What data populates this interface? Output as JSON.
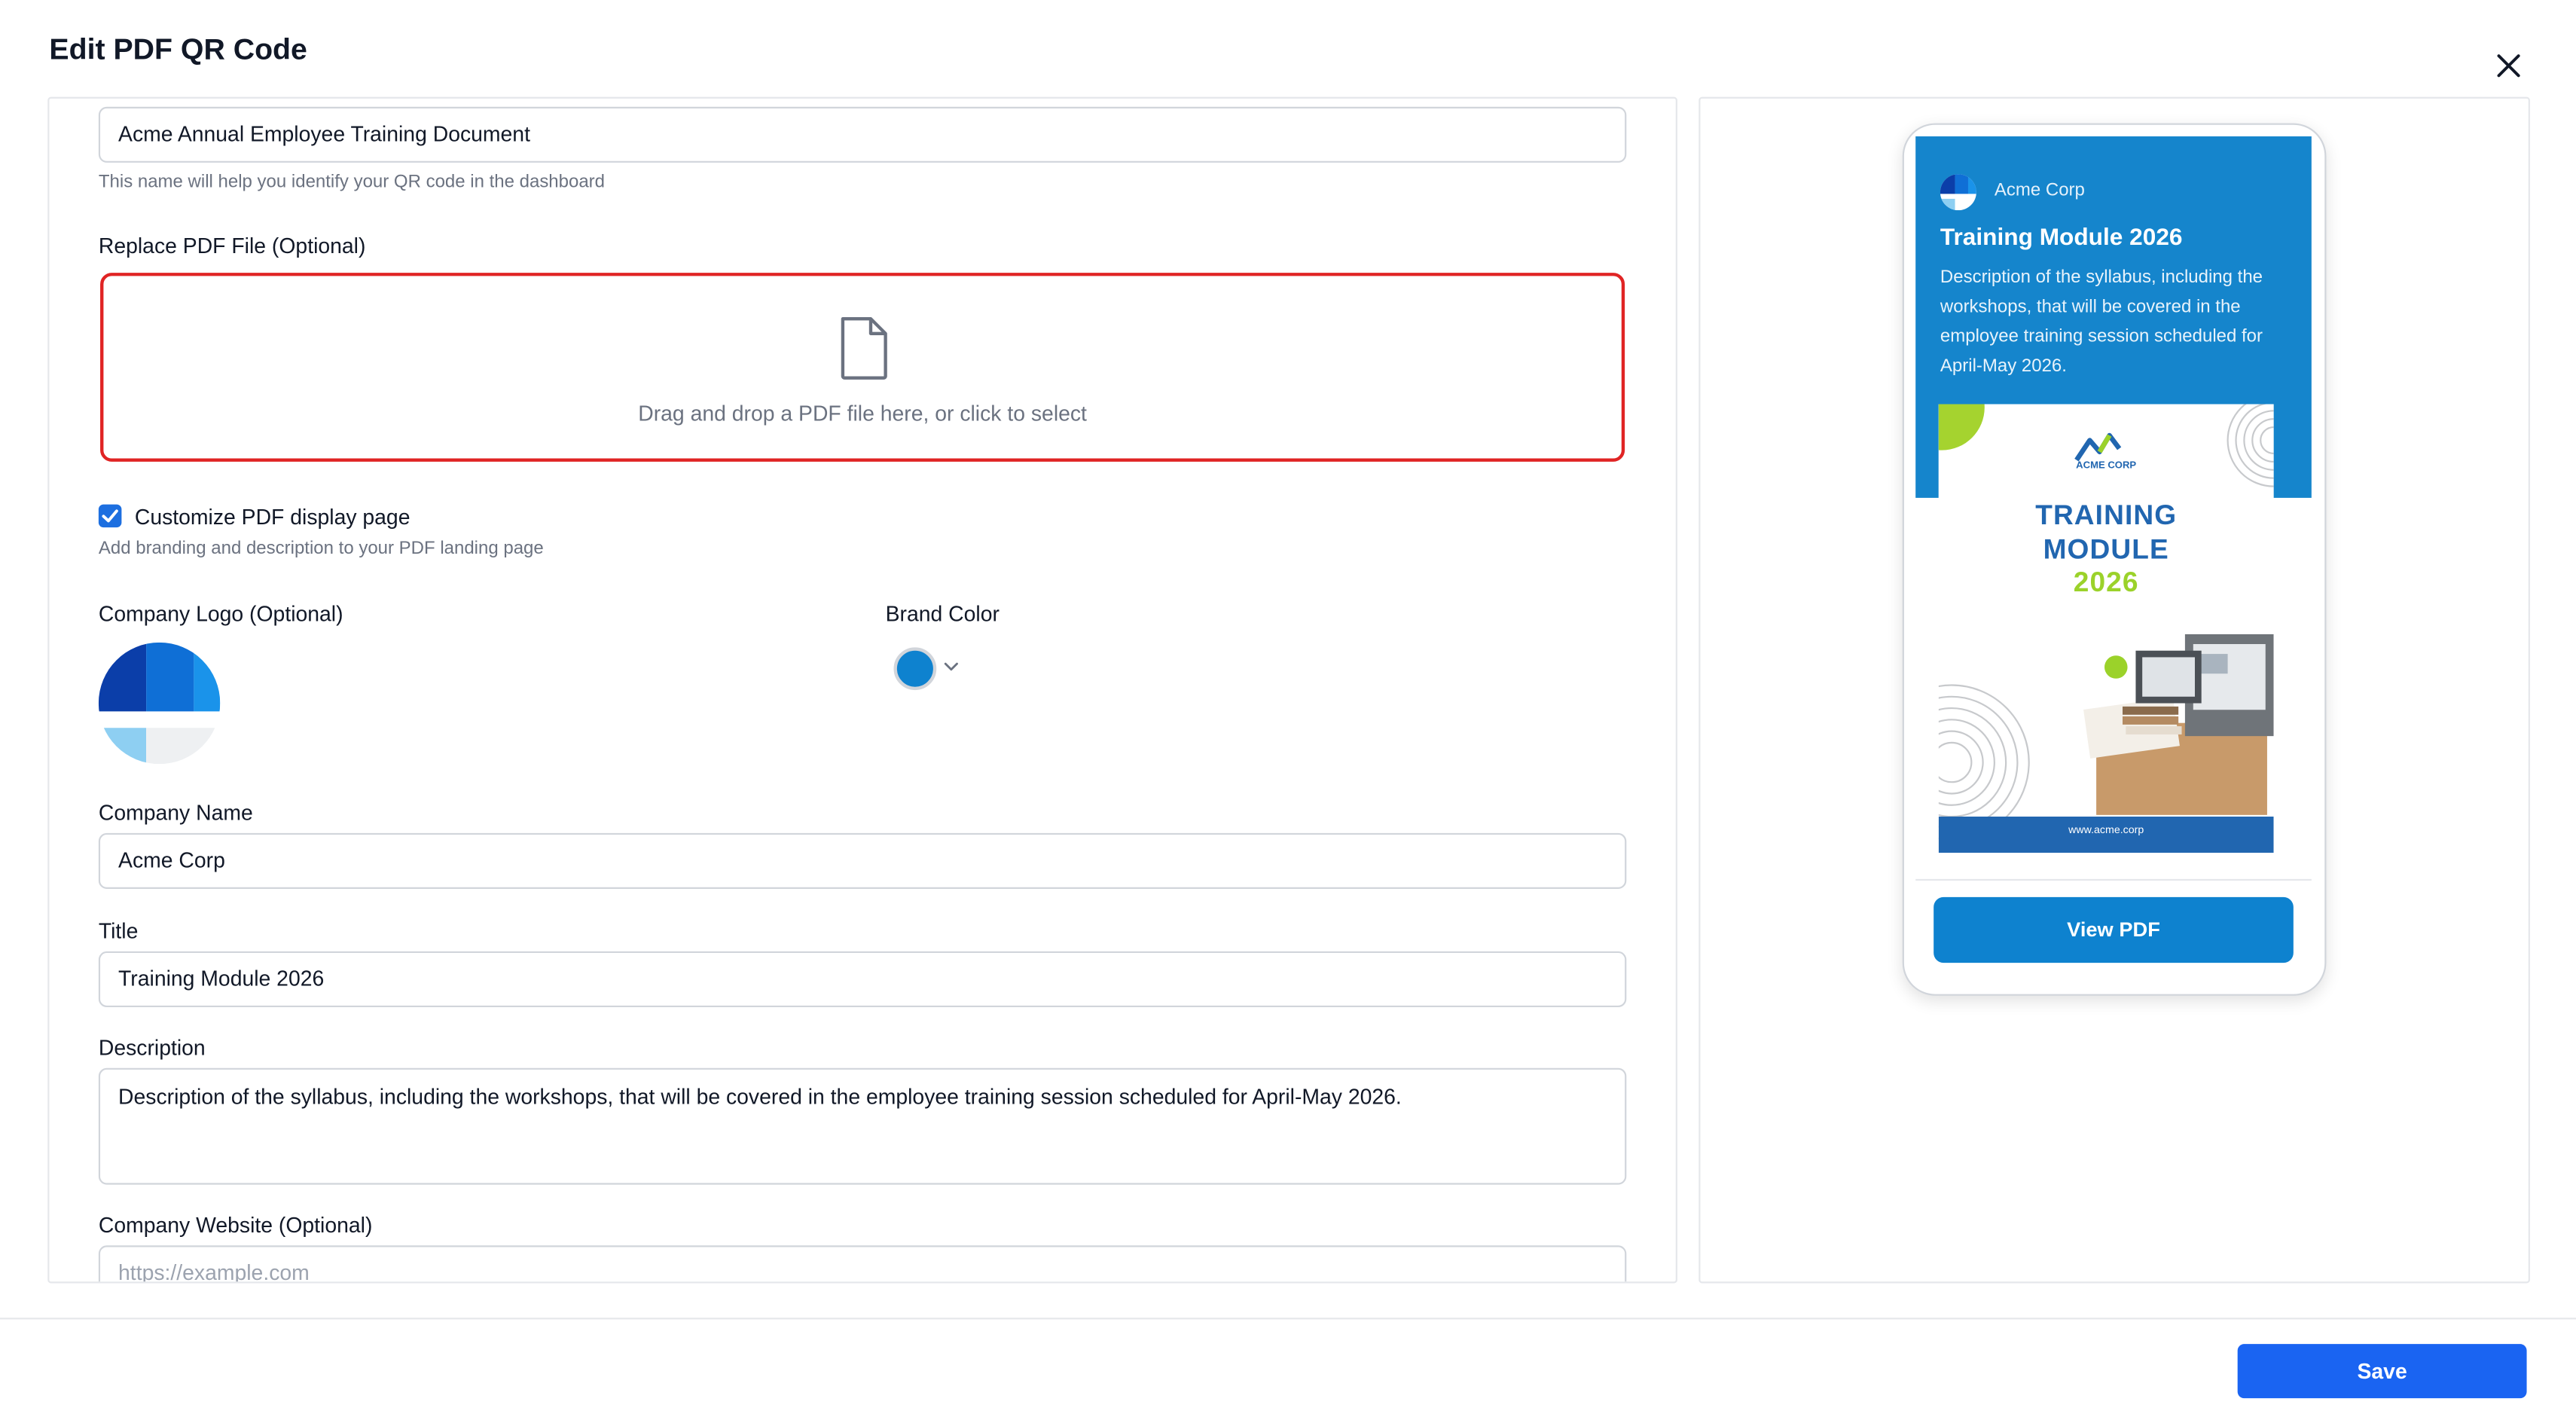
{
  "modal": {
    "title": "Edit PDF QR Code",
    "close_icon": "close-icon"
  },
  "form": {
    "name_value": "Acme Annual Employee Training Document",
    "name_hint": "This name will help you identify your QR code in the dashboard",
    "replace_label": "Replace PDF File (Optional)",
    "dropzone_icon": "file-icon",
    "dropzone_text": "Drag and drop a PDF file here, or click to select",
    "customize_label": "Customize PDF display page",
    "customize_checked": true,
    "customize_hint": "Add branding and description to your PDF landing page",
    "logo_label": "Company Logo (Optional)",
    "brand_color_label": "Brand Color",
    "brand_color": "#0e82cf",
    "company_name_label": "Company Name",
    "company_name_value": "Acme Corp",
    "title_label": "Title",
    "title_value": "Training Module 2026",
    "description_label": "Description",
    "description_value": "Description of the syllabus, including the workshops, that will be covered in the employee training session scheduled for April-May 2026.",
    "website_label": "Company Website (Optional)",
    "website_placeholder": "https://example.com"
  },
  "preview": {
    "company": "Acme Corp",
    "title": "Training Module 2026",
    "description": "Description of the syllabus, including the workshops, that will be covered in the employee training session scheduled for April-May 2026.",
    "doc_brand": "ACME CORP",
    "doc_heading_1": "TRAINING",
    "doc_heading_2": "MODULE",
    "doc_heading_3": "2026",
    "doc_url": "www.acme.corp",
    "view_button": "View PDF"
  },
  "footer": {
    "save_label": "Save"
  },
  "colors": {
    "accent": "#1a64f2",
    "error": "#e02424",
    "brand": "#0e82cf"
  }
}
